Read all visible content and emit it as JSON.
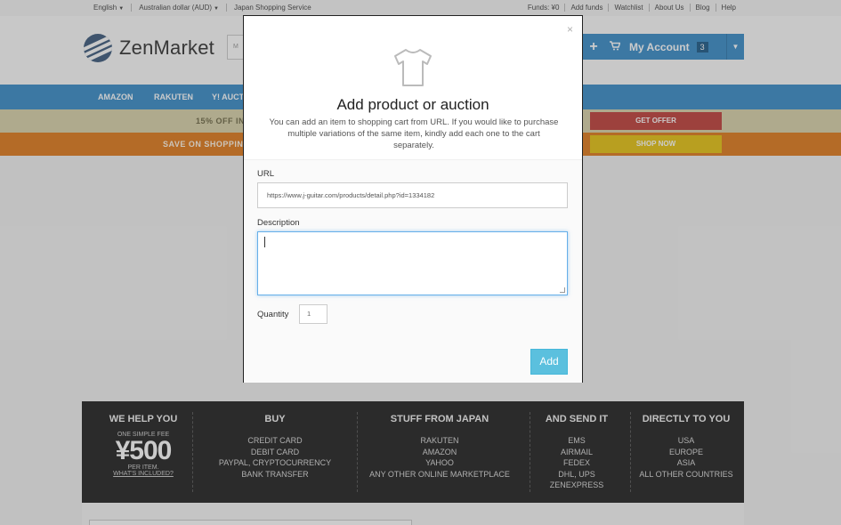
{
  "topbar": {
    "language": "English",
    "currency": "Australian dollar (AUD)",
    "service": "Japan Shopping Service",
    "links": [
      "Funds: ¥0",
      "Add funds",
      "Watchlist",
      "About Us",
      "Blog",
      "Help"
    ]
  },
  "header": {
    "logo_text": "ZenMarket",
    "search_placeholder_fragment": "M",
    "account_label": "My Account",
    "cart_count": "3"
  },
  "nav": {
    "items": [
      "AMAZON",
      "RAKUTEN",
      "Y! AUCT"
    ]
  },
  "promos": [
    {
      "text": "15% OFF IN",
      "button": "GET OFFER"
    },
    {
      "text": "SAVE ON SHOPPING",
      "button": "SHOP NOW"
    }
  ],
  "footer_band": {
    "we_help": {
      "title": "WE HELP YOU",
      "line1": "ONE SIMPLE FEE",
      "price": "¥500",
      "line2": "PER ITEM.",
      "link": "WHAT'S INCLUDED?"
    },
    "buy": {
      "title": "BUY",
      "items": [
        "CREDIT CARD",
        "DEBIT CARD",
        "PAYPAL, CRYPTOCURRENCY",
        "BANK TRANSFER"
      ]
    },
    "stuff": {
      "title": "STUFF FROM JAPAN",
      "items": [
        "RAKUTEN",
        "AMAZON",
        "YAHOO",
        "ANY OTHER ONLINE MARKETPLACE"
      ]
    },
    "send": {
      "title": "AND SEND IT",
      "items": [
        "EMS",
        "AIRMAIL",
        "FEDEX",
        "DHL, UPS",
        "ZENEXPRESS"
      ]
    },
    "directly": {
      "title": "DIRECTLY TO YOU",
      "items": [
        "USA",
        "EUROPE",
        "ASIA",
        "ALL OTHER COUNTRIES"
      ]
    }
  },
  "modal": {
    "close": "×",
    "title": "Add product or auction",
    "description": "You can add an item to shopping cart from URL. If you would like to purchase multiple variations of the same item, kindly add each one to the cart separately.",
    "url_label": "URL",
    "url_value": "https://www.j-guitar.com/products/detail.php?id=1334182",
    "description_label": "Description",
    "description_value": "",
    "quantity_label": "Quantity",
    "quantity_value": "1",
    "add_button": "Add"
  },
  "colors": {
    "brand_blue": "#3a8cc8",
    "add_button": "#5bc0de",
    "promo_red": "#c0403b",
    "promo_orange": "#e07a1c",
    "promo_yellow": "#e5c313"
  }
}
